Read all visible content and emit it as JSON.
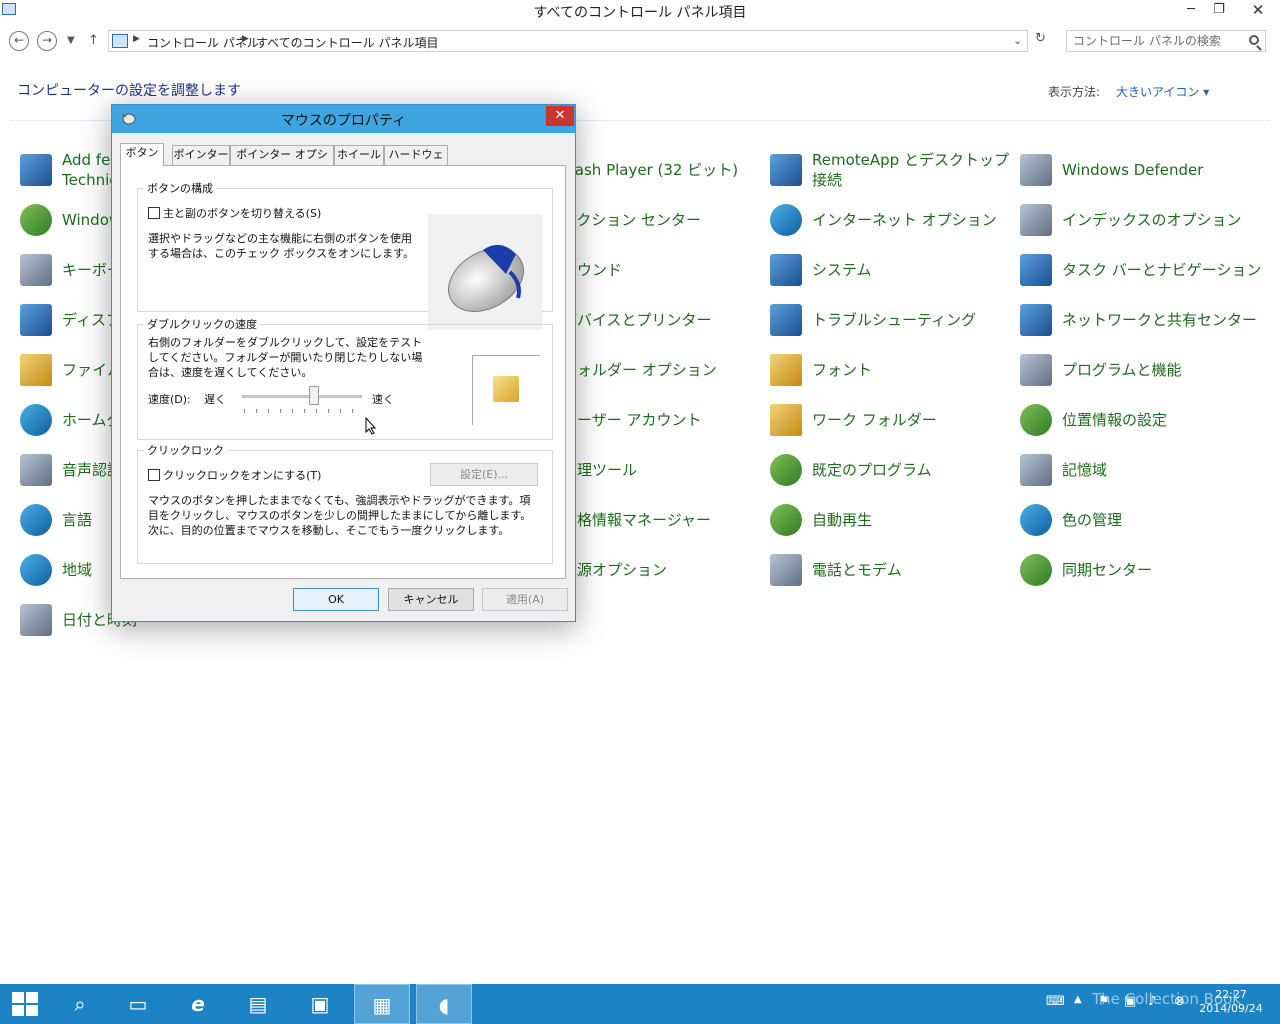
{
  "window": {
    "title": "すべてのコントロール パネル項目",
    "minimize": "─",
    "restore": "❐",
    "close": "✕"
  },
  "address": {
    "crumbs": [
      "コントロール パネル",
      "すべてのコントロール パネル項目"
    ],
    "search_placeholder": "コントロール パネルの検索"
  },
  "header": {
    "title": "コンピューターの設定を調整します",
    "view_label": "表示方法:",
    "view_value": "大きいアイコン ▾"
  },
  "items": {
    "col1": [
      "Add features to Windows Technical Preview",
      "Windows Update",
      "キーボード",
      "ディスプレイ",
      "ファイル履歴",
      "ホームグループ",
      "音声認識",
      "言語",
      "地域",
      "日付と時刻"
    ],
    "col2": [
      "Flash Player (32 ビット)",
      "アクション センター",
      "サウンド",
      "デバイスとプリンター",
      "フォルダー オプション",
      "ユーザー アカウント",
      "管理ツール",
      "資格情報マネージャー",
      "電源オプション"
    ],
    "col3": [
      "RemoteApp とデスクトップ接続",
      "インターネット オプション",
      "システム",
      "トラブルシューティング",
      "フォント",
      "ワーク フォルダー",
      "既定のプログラム",
      "自動再生",
      "電話とモデム"
    ],
    "col4": [
      "Windows Defender",
      "インデックスのオプション",
      "タスク バーとナビゲーション",
      "ネットワークと共有センター",
      "プログラムと機能",
      "位置情報の設定",
      "記憶域",
      "色の管理",
      "同期センター"
    ]
  },
  "dialog": {
    "title": "マウスのプロパティ",
    "close": "✕",
    "tabs": [
      "ボタン",
      "ポインター",
      "ポインター オプション",
      "ホイール",
      "ハードウェア"
    ],
    "button_config": {
      "title": "ボタンの構成",
      "checkbox": "主と副のボタンを切り替える(S)",
      "desc": "選択やドラッグなどの主な機能に右側のボタンを使用する場合は、このチェック ボックスをオンにします。"
    },
    "dblclick": {
      "title": "ダブルクリックの速度",
      "desc": "右側のフォルダーをダブルクリックして、設定をテストしてください。フォルダーが開いたり閉じたりしない場合は、速度を遅くしてください。",
      "speed_label": "速度(D):",
      "slow": "遅く",
      "fast": "速く",
      "speed_level": 0.6
    },
    "clicklock": {
      "title": "クリックロック",
      "checkbox": "クリックロックをオンにする(T)",
      "settings_button": "設定(E)...",
      "desc": "マウスのボタンを押したままでなくても、強調表示やドラッグができます。項目をクリックし、マウスのボタンを少しの間押したままにしてから離します。次に、目的の位置までマウスを移動し、そこでもう一度クリックします。"
    },
    "buttons": {
      "ok": "OK",
      "cancel": "キャンセル",
      "apply": "適用(A)"
    }
  },
  "taskbar": {
    "time": "22:27",
    "date": "2014/09/24",
    "watermark": "The Collection Book"
  }
}
